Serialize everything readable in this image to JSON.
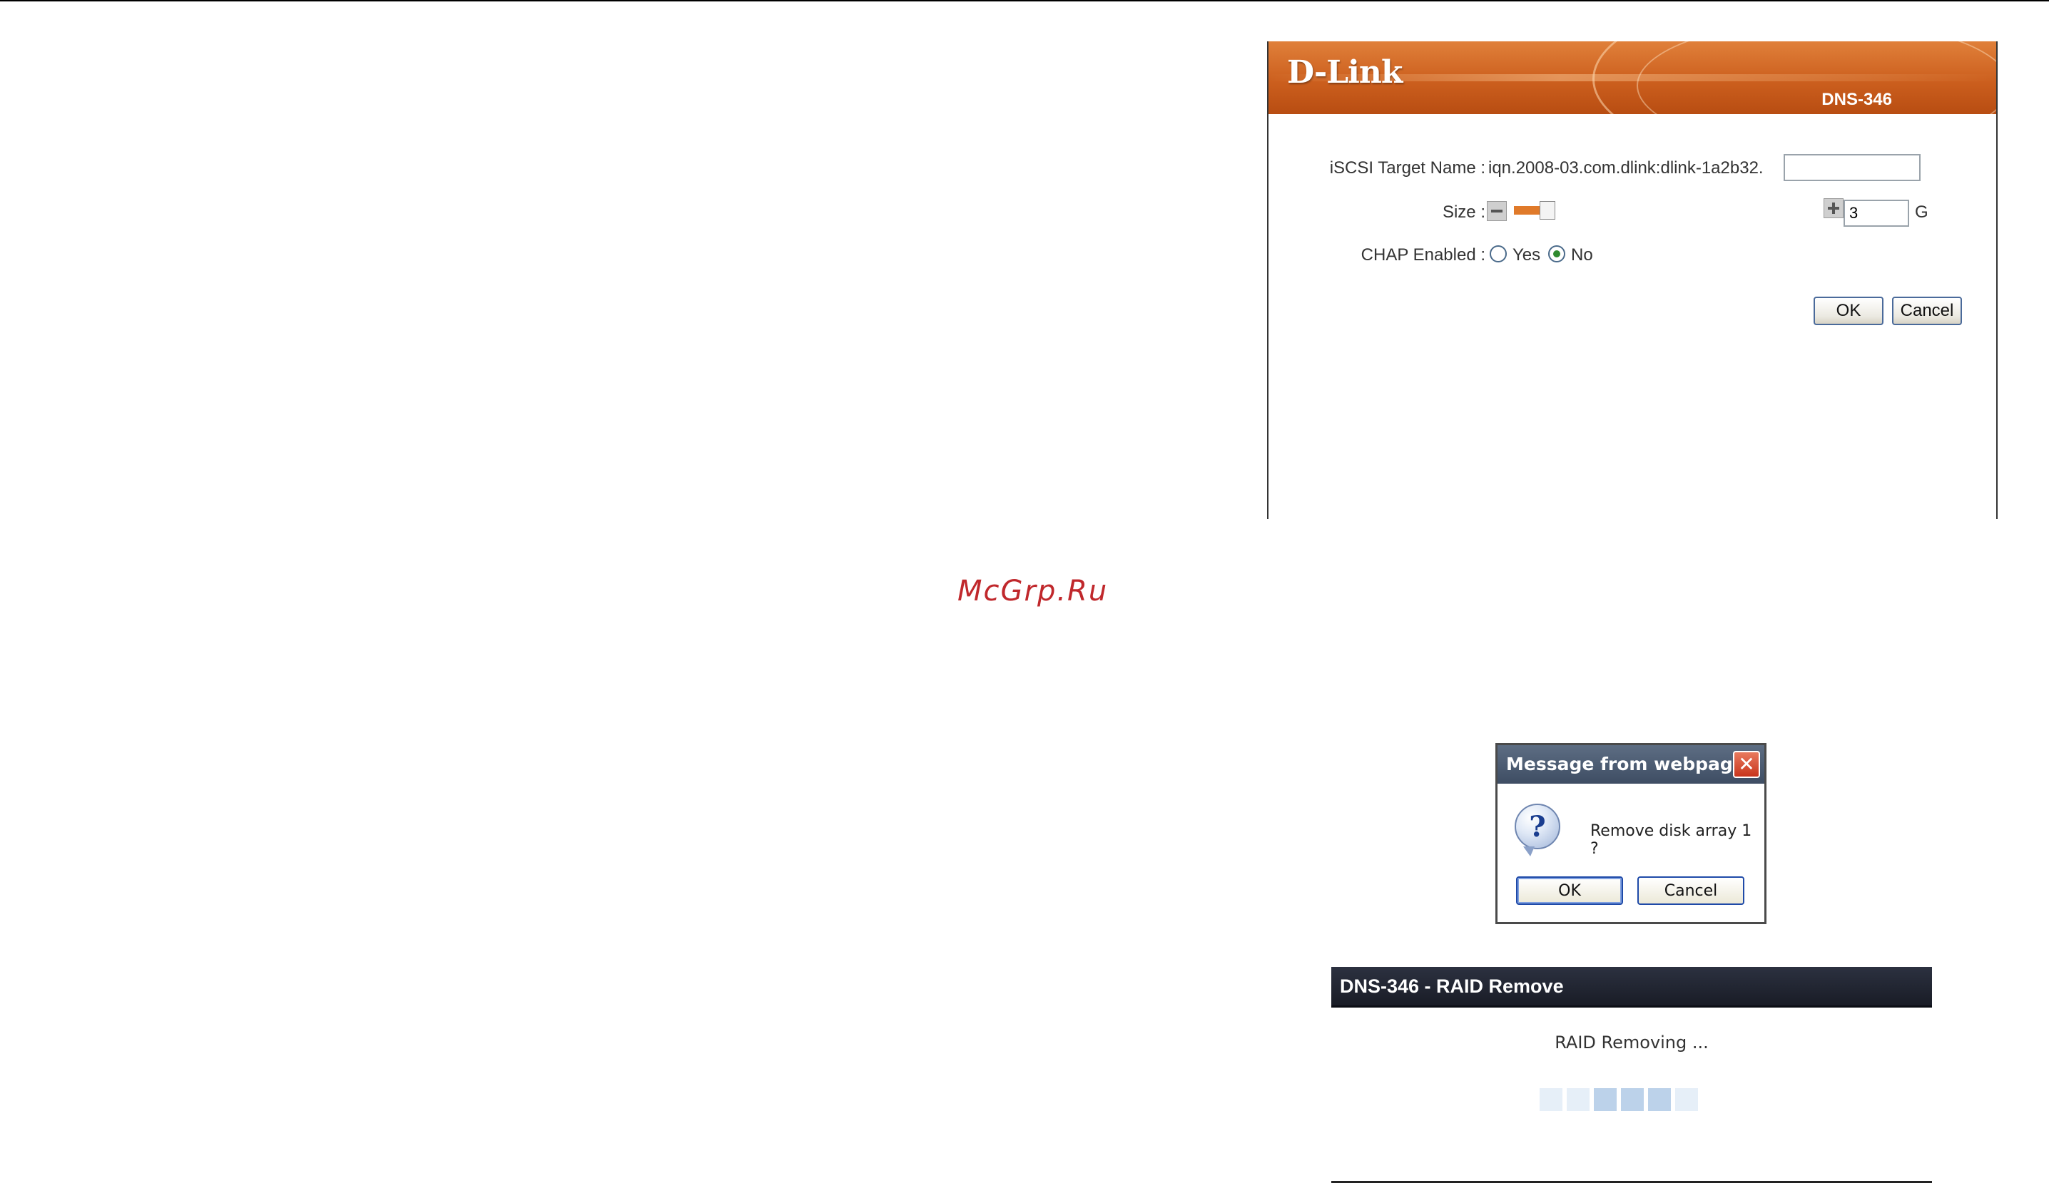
{
  "iscsi_panel": {
    "logo": "D-Link",
    "model": "DNS-346",
    "target_name_label": "iSCSI Target Name :",
    "target_name_prefix": "iqn.2008-03.com.dlink:dlink-1a2b32.",
    "target_name_value": "",
    "size_label": "Size :",
    "size_value": "3",
    "size_unit": "G",
    "size_slider_fraction": 0.02,
    "chap_label": "CHAP Enabled :",
    "chap_options": [
      "Yes",
      "No"
    ],
    "chap_selected": "No",
    "ok_label": "OK",
    "cancel_label": "Cancel",
    "accent_color": "#e07a2a"
  },
  "watermark": "McGrp.Ru",
  "message_dialog": {
    "title": "Message from webpage",
    "close_glyph": "✕",
    "icon": "question-icon",
    "icon_glyph": "?",
    "text": "Remove disk array 1 ?",
    "ok_label": "OK",
    "cancel_label": "Cancel"
  },
  "raid_panel": {
    "title": "DNS-346 - RAID Remove",
    "status": "RAID Removing ...",
    "progress_blocks_total": 6,
    "progress_blocks_active": [
      2,
      3,
      4
    ]
  }
}
